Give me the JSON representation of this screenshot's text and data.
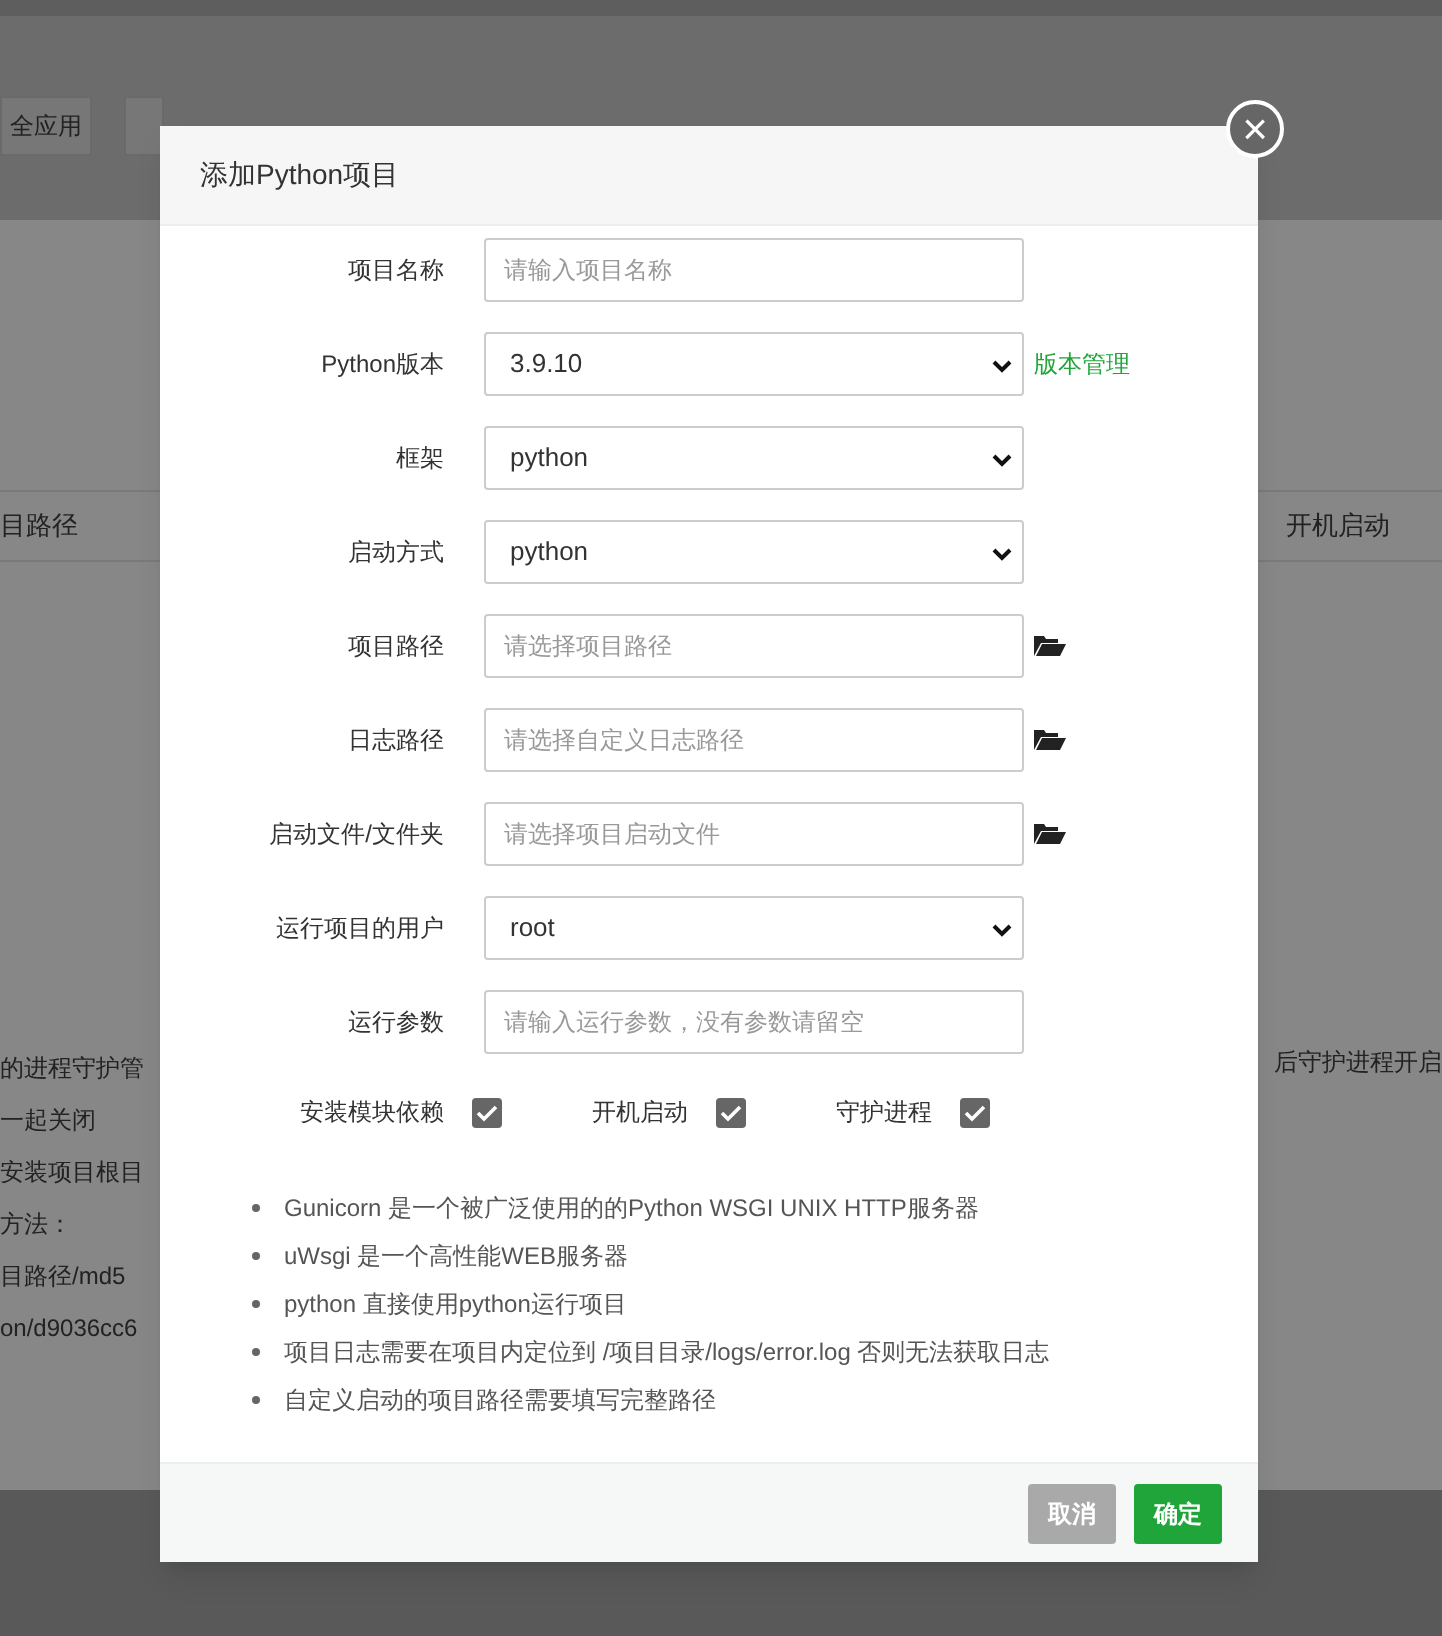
{
  "background": {
    "button_label": "全应用",
    "column_1": "目路径",
    "column_2": "开机启动",
    "left_lines": [
      "的进程守护管",
      "一起关闭",
      "安装项目根目",
      "方法：",
      "目路径/md5",
      "on/d9036cc6"
    ],
    "right_line": "后守护进程开启"
  },
  "dialog": {
    "title": "添加Python项目",
    "close": "×",
    "fields": [
      {
        "kind": "input",
        "label": "项目名称",
        "placeholder": "请输入项目名称",
        "browse": false
      },
      {
        "kind": "select",
        "label": "Python版本",
        "value": "3.9.10",
        "link": "版本管理"
      },
      {
        "kind": "select",
        "label": "框架",
        "value": "python"
      },
      {
        "kind": "select",
        "label": "启动方式",
        "value": "python"
      },
      {
        "kind": "input",
        "label": "项目路径",
        "placeholder": "请选择项目路径",
        "browse": true
      },
      {
        "kind": "input",
        "label": "日志路径",
        "placeholder": "请选择自定义日志路径",
        "browse": true
      },
      {
        "kind": "input",
        "label": "启动文件/文件夹",
        "placeholder": "请选择项目启动文件",
        "browse": true
      },
      {
        "kind": "select",
        "label": "运行项目的用户",
        "value": "root"
      },
      {
        "kind": "input",
        "label": "运行参数",
        "placeholder": "请输入运行参数，没有参数请留空",
        "browse": false
      }
    ],
    "checkboxes": [
      {
        "label": "安装模块依赖",
        "checked": true
      },
      {
        "label": "开机启动",
        "checked": true
      },
      {
        "label": "守护进程",
        "checked": true
      }
    ],
    "notes": [
      "Gunicorn 是一个被广泛使用的的Python WSGI UNIX HTTP服务器",
      "uWsgi 是一个高性能WEB服务器",
      "python 直接使用python运行项目",
      "项目日志需要在项目内定位到 /项目目录/logs/error.log 否则无法获取日志",
      "自定义启动的项目路径需要填写完整路径"
    ],
    "buttons": [
      {
        "label": "取消",
        "kind": "cancel"
      },
      {
        "label": "确定",
        "kind": "confirm"
      }
    ]
  }
}
